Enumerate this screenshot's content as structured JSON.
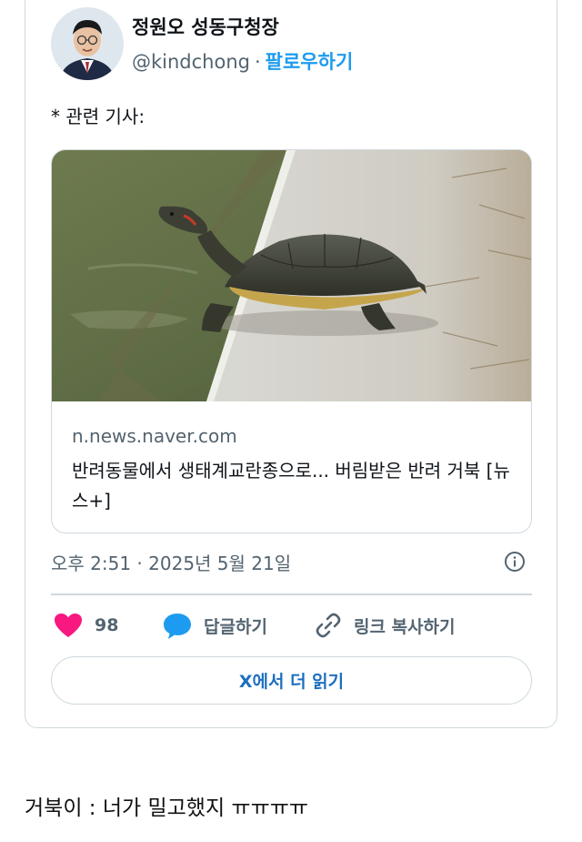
{
  "tweet": {
    "author_name": "정원오 성동구청장",
    "handle": "@kindchong",
    "separator": "·",
    "follow_label": "팔로우하기",
    "text": "* 관련 기사:",
    "link_card": {
      "domain": "n.news.naver.com",
      "title": "반려동물에서 생태계교란종으로... 버림받은 반려 거북 [뉴스+]"
    },
    "timestamp": "오후 2:51 · 2025년 5월 21일",
    "actions": {
      "likes_count": "98",
      "reply_label": "답글하기",
      "copy_link_label": "링크 복사하기"
    },
    "read_more_label": "X에서 더 읽기"
  },
  "caption": "거북이 : 너가 밀고했지 ㅠㅠㅠㅠ",
  "colors": {
    "accent": "#1d9bf0",
    "like": "#f91880",
    "reply": "#1d9bf0",
    "border": "#cfd9de",
    "muted": "#536471"
  },
  "icons": [
    "info-icon",
    "heart-icon",
    "speech-bubble-icon",
    "link-icon"
  ]
}
